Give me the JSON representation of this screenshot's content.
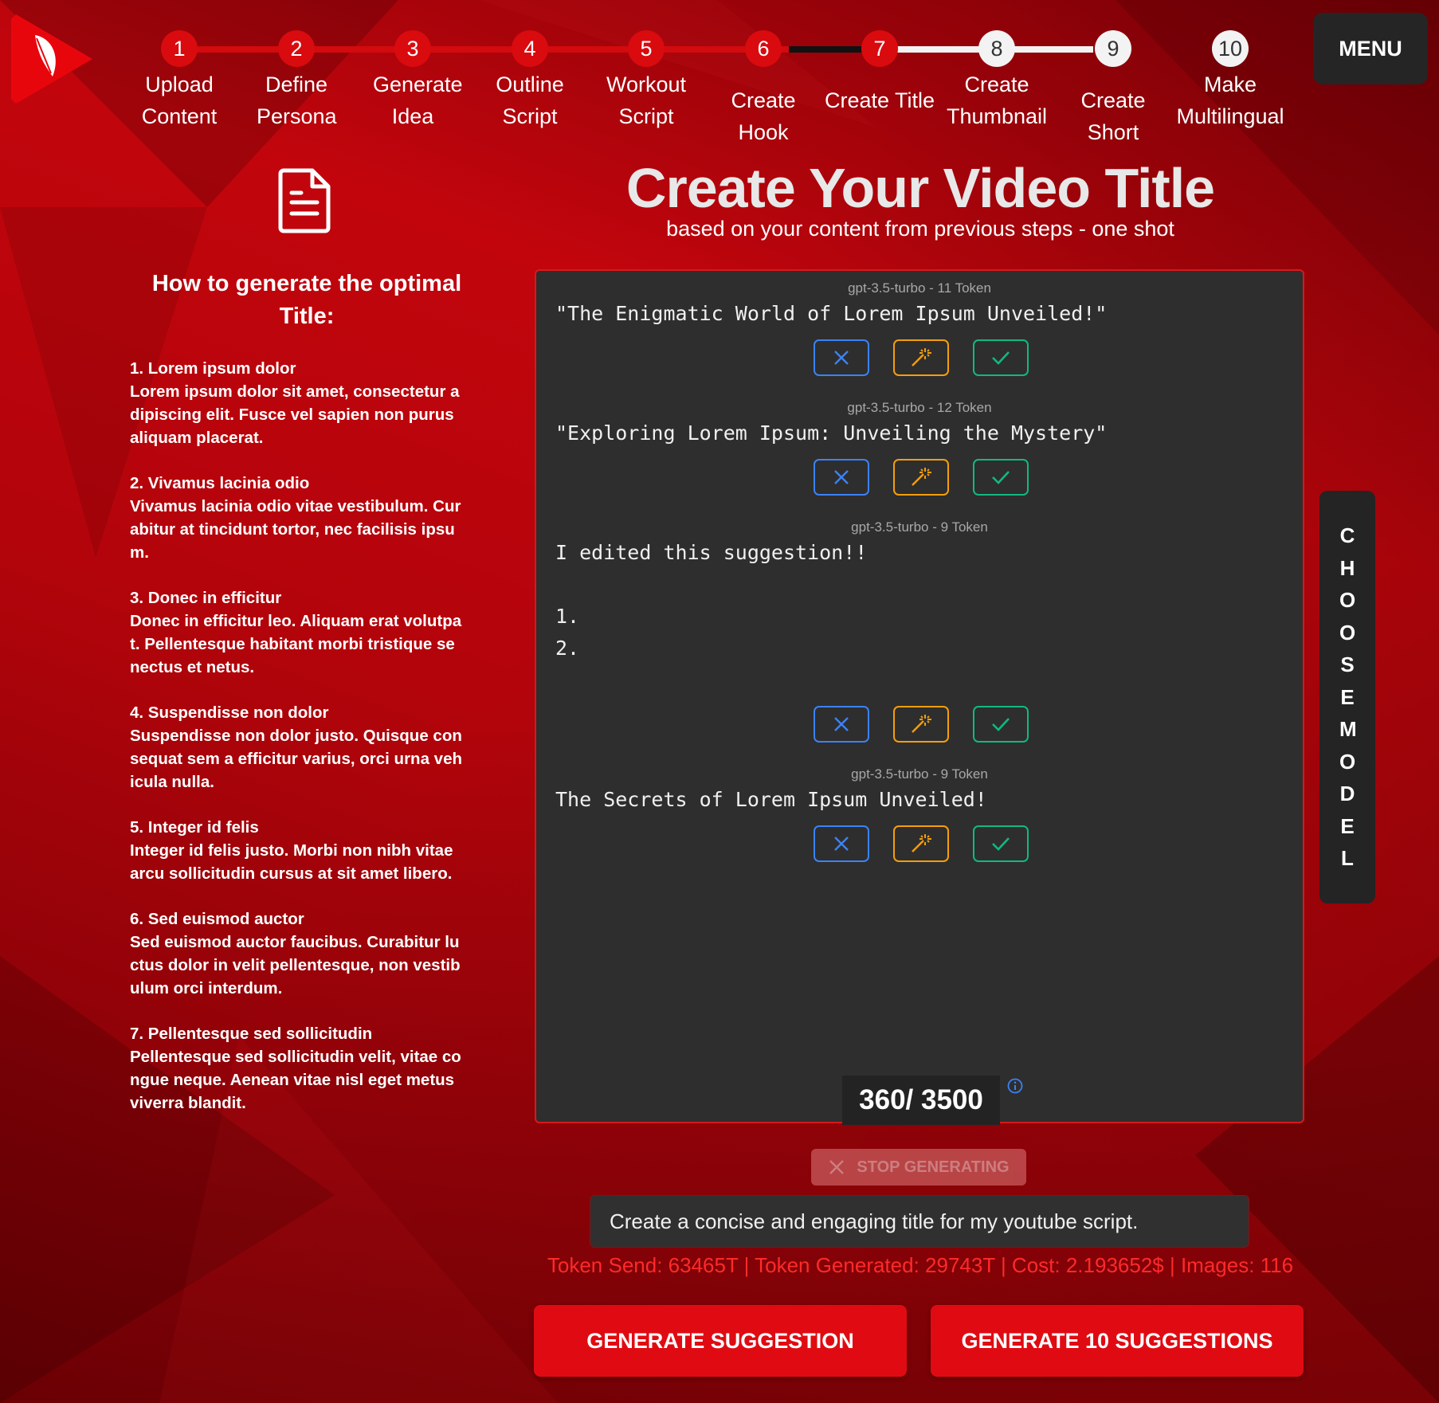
{
  "colors": {
    "brand_red": "#d90b0f",
    "panel_bg": "#2e2e2e",
    "reject": "#3b82f6",
    "improve": "#f59e0b",
    "accept": "#10b981",
    "stats_text": "#ff2a2a"
  },
  "header": {
    "logo_icon": "feather-play-logo-icon",
    "menu_label": "MENU",
    "steps": [
      {
        "num": "1",
        "label": "Upload Content",
        "done": true
      },
      {
        "num": "2",
        "label": "Define Persona",
        "done": true
      },
      {
        "num": "3",
        "label": "Generate Idea",
        "done": true
      },
      {
        "num": "4",
        "label": "Outline Script",
        "done": true
      },
      {
        "num": "5",
        "label": "Workout Script",
        "done": true
      },
      {
        "num": "6",
        "label": "Create Hook",
        "done": true
      },
      {
        "num": "7",
        "label": "Create Title",
        "done": true
      },
      {
        "num": "8",
        "label": "Create Thumbnail",
        "done": false
      },
      {
        "num": "9",
        "label": "Create Short",
        "done": false
      },
      {
        "num": "10",
        "label": "Make Multilingual",
        "done": false
      }
    ]
  },
  "sidebar": {
    "icon": "document-icon",
    "title": "How to generate the optimal Title:",
    "items": [
      {
        "heading": "1. Lorem ipsum dolor",
        "body": "Lorem ipsum dolor sit amet, consectetur adipiscing elit. Fusce vel sapien non purus aliquam placerat."
      },
      {
        "heading": "2. Vivamus lacinia odio",
        "body": "Vivamus lacinia odio vitae vestibulum. Curabitur at tincidunt tortor, nec facilisis ipsum."
      },
      {
        "heading": "3. Donec in efficitur",
        "body": "Donec in efficitur leo. Aliquam erat volutpat. Pellentesque habitant morbi tristique senectus et netus."
      },
      {
        "heading": "4. Suspendisse non dolor",
        "body": "Suspendisse non dolor justo. Quisque consequat sem a efficitur varius, orci urna vehicula nulla."
      },
      {
        "heading": "5. Integer id felis",
        "body": "Integer id felis justo. Morbi non nibh vitae arcu sollicitudin cursus at sit amet libero."
      },
      {
        "heading": "6. Sed euismod auctor",
        "body": "Sed euismod auctor faucibus. Curabitur luctus dolor in velit pellentesque, non vestibulum orci interdum."
      },
      {
        "heading": "7. Pellentesque sed sollicitudin",
        "body": "Pellentesque sed sollicitudin velit, vitae congue neque. Aenean vitae nisl eget metus viverra blandit."
      }
    ]
  },
  "main": {
    "title": "Create Your Video Title",
    "subtitle": "based on your content from previous steps - one shot",
    "suggestions": [
      {
        "meta": "gpt-3.5-turbo - 11 Token",
        "text": "\"The Enigmatic World of Lorem Ipsum Unveiled!\""
      },
      {
        "meta": "gpt-3.5-turbo - 12 Token",
        "text": "\"Exploring Lorem Ipsum: Unveiling the Mystery\""
      },
      {
        "meta": "gpt-3.5-turbo - 9 Token",
        "text": "I edited this suggestion!!\n\n1.\n2."
      },
      {
        "meta": "gpt-3.5-turbo - 9 Token",
        "text": "The Secrets of Lorem Ipsum Unveiled!"
      }
    ],
    "counter": "360/ 3500",
    "info_icon": "info-icon"
  },
  "side_tab": {
    "label": "CHOOSE MODEL"
  },
  "controls": {
    "stop_label": "STOP GENERATING",
    "prompt_value": "Create a concise and engaging title for my youtube script.",
    "stats": "Token Send: 63465T  | Token  Generated: 29743T  |  Cost: 2.193652$  | Images: 116",
    "generate_one": "GENERATE SUGGESTION",
    "generate_ten": "GENERATE 10 SUGGESTIONS"
  }
}
